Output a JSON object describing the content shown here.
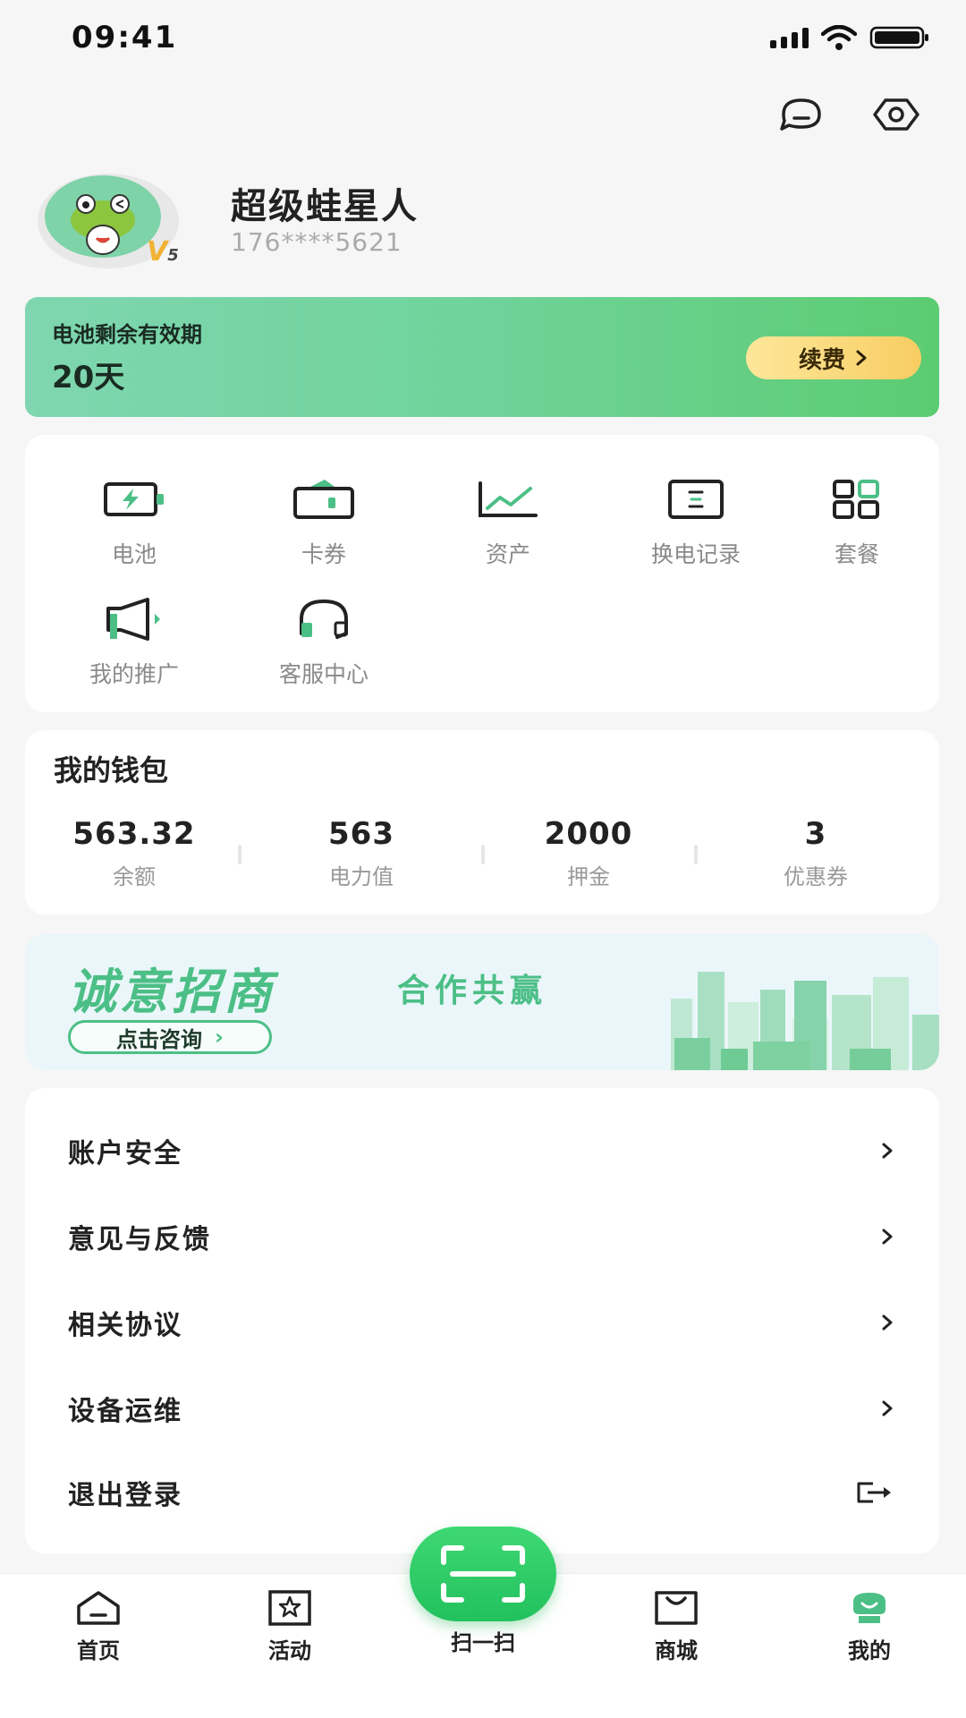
{
  "status_bar": {
    "time": "09:41"
  },
  "profile": {
    "name": "超级蛙星人",
    "phone": "176****5621",
    "vip_level": "V",
    "vip_sub": "5"
  },
  "battery_card": {
    "title": "电池剩余有效期",
    "days": "20天",
    "renew_label": "续费"
  },
  "menu": {
    "items": [
      {
        "label": "电池",
        "icon": "battery-icon"
      },
      {
        "label": "卡券",
        "icon": "wallet-icon"
      },
      {
        "label": "资产",
        "icon": "chart-icon"
      },
      {
        "label": "换电记录",
        "icon": "record-icon"
      },
      {
        "label": "套餐",
        "icon": "grid-icon"
      },
      {
        "label": "我的推广",
        "icon": "megaphone-icon"
      },
      {
        "label": "客服中心",
        "icon": "headset-icon"
      }
    ]
  },
  "wallet": {
    "title": "我的钱包",
    "stats": [
      {
        "value": "563.32",
        "label": "余额"
      },
      {
        "value": "563",
        "label": "电力值"
      },
      {
        "value": "2000",
        "label": "押金"
      },
      {
        "value": "3",
        "label": "优惠券"
      }
    ]
  },
  "banner": {
    "title": "诚意招商",
    "subtitle": "合作共赢",
    "button": "点击咨询"
  },
  "settings": {
    "items": [
      {
        "label": "账户安全"
      },
      {
        "label": "意见与反馈"
      },
      {
        "label": "相关协议"
      },
      {
        "label": "设备运维"
      },
      {
        "label": "退出登录"
      }
    ]
  },
  "tabbar": {
    "items": [
      {
        "label": "首页",
        "icon": "home-icon"
      },
      {
        "label": "活动",
        "icon": "star-icon"
      },
      {
        "label": "扫一扫",
        "icon": "scan-icon"
      },
      {
        "label": "商城",
        "icon": "shop-bag-icon"
      },
      {
        "label": "我的",
        "icon": "profile-icon"
      }
    ],
    "active": "我的"
  },
  "colors": {
    "accent": "#4cbf86",
    "primary_green": "#22c15e",
    "gold": "#f8cd62",
    "background": "#f6f6f6"
  }
}
